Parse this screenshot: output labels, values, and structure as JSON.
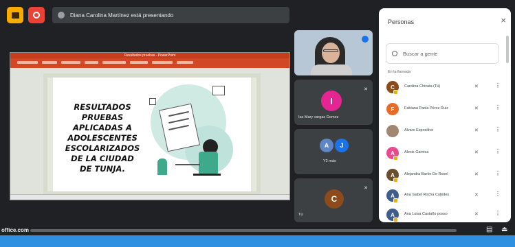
{
  "topbar": {
    "presenting_text": "Diana Carolina Martínez está presentando"
  },
  "slide": {
    "window_title": "Resultados pruebas - PowerPoint",
    "text": "RESULTADOS\nPRUEBAS\nAPLICADAS A\nADOLESCENTES\nESCOLARIZADOS\nDE LA CIUDAD\nDE TUNJA."
  },
  "tiles": [
    {
      "initial": "",
      "name": ""
    },
    {
      "initial": "I",
      "name": "Isa Mary vargas Gomez"
    },
    {
      "initial_a": "A",
      "initial_j": "J",
      "name": "Y2 más"
    },
    {
      "initial": "C",
      "name": "Tú"
    }
  ],
  "people": {
    "title": "Personas",
    "close_icon": "×",
    "search_placeholder": "Buscar a gente",
    "section_label": "En la llamada",
    "participants": [
      {
        "initial": "C",
        "name": "Carolina Chivata (Tú)",
        "color": "#8d4a1b",
        "host": true
      },
      {
        "initial": "F",
        "name": "Fabiana Paola Pérez Ruiz",
        "color": "#ea6a2a",
        "host": false
      },
      {
        "initial": "",
        "name": "Álvaro Espositivo",
        "color": "#a08870",
        "host": false
      },
      {
        "initial": "A",
        "name": "Alexis Garnica",
        "color": "#e84a8f",
        "host": true
      },
      {
        "initial": "A",
        "name": "Alejandra Barón De Rosel",
        "color": "#6b4e2e",
        "host": true
      },
      {
        "initial": "A",
        "name": "Ana Isabel Rocha Cubides",
        "color": "#3f5e8c",
        "host": true
      },
      {
        "initial": "A",
        "name": "Ana Luisa Castaño posso",
        "color": "#3f5e8c",
        "host": true
      }
    ]
  },
  "browser": {
    "url_prefix": "office.com"
  },
  "colors": {
    "meet_bg": "#202124",
    "ppt_orange": "#d24726",
    "taskbar": "#2f8fe0"
  }
}
